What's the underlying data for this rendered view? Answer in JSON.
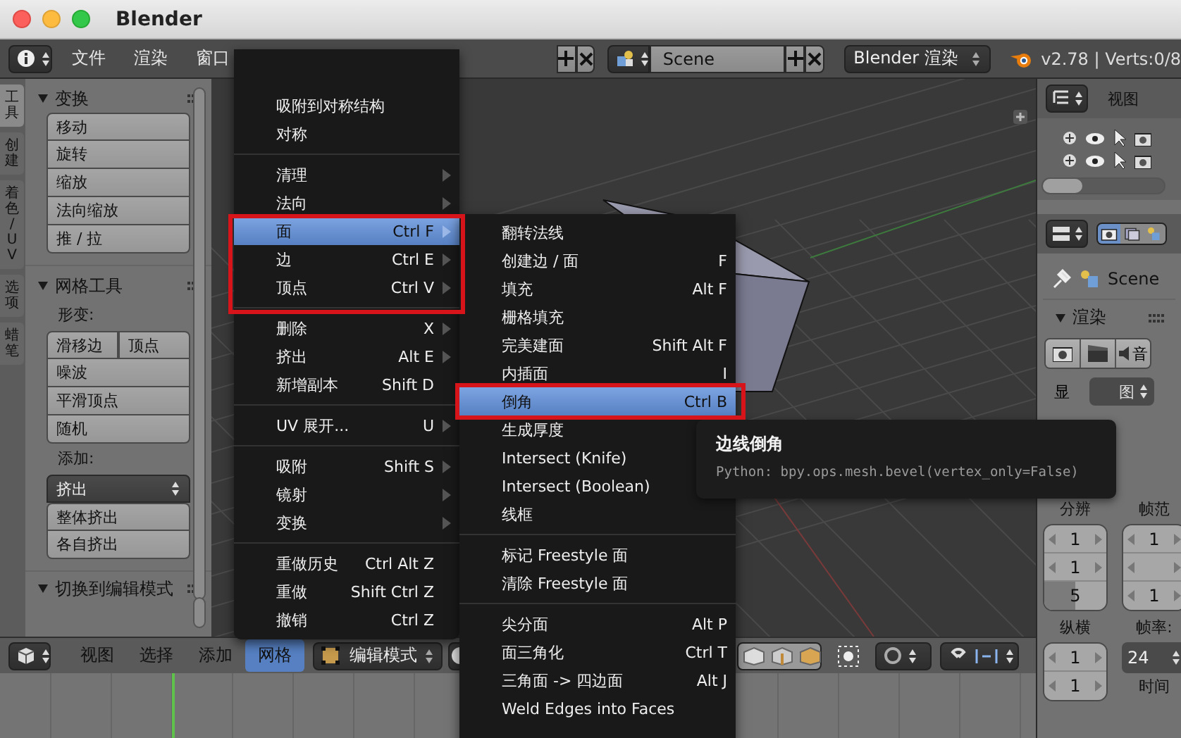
{
  "window": {
    "title": "Blender"
  },
  "top_header": {
    "menus": [
      {
        "label": "文件"
      },
      {
        "label": "渲染"
      },
      {
        "label": "窗口"
      }
    ],
    "scene": "Scene",
    "render_engine": "Blender 渲染",
    "version": "v2.78 | Verts:0/8"
  },
  "tool_tabs": [
    {
      "label": "工具",
      "selected": true
    },
    {
      "label": "创建",
      "selected": false
    },
    {
      "label": "着色 / UV",
      "selected": false
    },
    {
      "label": "选项",
      "selected": false
    },
    {
      "label": "蜡笔",
      "selected": false
    }
  ],
  "tool_shelf": {
    "panels": [
      {
        "title": "变换",
        "items": [
          {
            "kind": "button",
            "label": "移动"
          },
          {
            "kind": "button",
            "label": "旋转"
          },
          {
            "kind": "button",
            "label": "缩放"
          },
          {
            "kind": "button",
            "label": "法向缩放"
          },
          {
            "kind": "button",
            "label": "推 / 拉"
          }
        ]
      },
      {
        "title": "网格工具",
        "items": [
          {
            "kind": "label",
            "label": "形变:"
          },
          {
            "kind": "pair",
            "labels": [
              "滑移边",
              "顶点"
            ]
          },
          {
            "kind": "button",
            "label": "噪波"
          },
          {
            "kind": "button",
            "label": "平滑顶点"
          },
          {
            "kind": "button",
            "label": "随机"
          },
          {
            "kind": "label",
            "label": "添加:"
          },
          {
            "kind": "dropdown",
            "label": "挤出"
          },
          {
            "kind": "button",
            "label": "整体挤出"
          },
          {
            "kind": "button",
            "label": "各自挤出"
          }
        ]
      },
      {
        "title": "切换到编辑模式"
      }
    ]
  },
  "main_menu": {
    "items": [
      {
        "kind": "item",
        "label": "吸附到对称结构",
        "submenu": false,
        "selected": false
      },
      {
        "kind": "item",
        "label": "对称",
        "submenu": false,
        "selected": false
      },
      {
        "kind": "separator"
      },
      {
        "kind": "item",
        "label": "清理",
        "submenu": true,
        "selected": false
      },
      {
        "kind": "item",
        "label": "法向",
        "submenu": true,
        "selected": false
      },
      {
        "kind": "item",
        "label": "面",
        "shortcut": "Ctrl F",
        "submenu": true,
        "selected": true
      },
      {
        "kind": "item",
        "label": "边",
        "shortcut": "Ctrl E",
        "submenu": true,
        "selected": false
      },
      {
        "kind": "item",
        "label": "顶点",
        "shortcut": "Ctrl V",
        "submenu": true,
        "selected": false
      },
      {
        "kind": "separator"
      },
      {
        "kind": "item",
        "label": "删除",
        "shortcut": "X",
        "submenu": true,
        "selected": false
      },
      {
        "kind": "item",
        "label": "挤出",
        "shortcut": "Alt E",
        "submenu": true,
        "selected": false
      },
      {
        "kind": "item",
        "label": "新增副本",
        "shortcut": "Shift D",
        "submenu": false,
        "selected": false
      },
      {
        "kind": "separator"
      },
      {
        "kind": "item",
        "label": "UV 展开...",
        "shortcut": "U",
        "submenu": true,
        "selected": false
      },
      {
        "kind": "separator"
      },
      {
        "kind": "item",
        "label": "吸附",
        "shortcut": "Shift S",
        "submenu": true,
        "selected": false
      },
      {
        "kind": "item",
        "label": "镜射",
        "submenu": true,
        "selected": false
      },
      {
        "kind": "item",
        "label": "变换",
        "submenu": true,
        "selected": false
      },
      {
        "kind": "separator"
      },
      {
        "kind": "item",
        "label": "重做历史",
        "shortcut": "Ctrl Alt Z",
        "submenu": false,
        "selected": false
      },
      {
        "kind": "item",
        "label": "重做",
        "shortcut": "Shift Ctrl Z",
        "submenu": false,
        "selected": false
      },
      {
        "kind": "item",
        "label": "撤销",
        "shortcut": "Ctrl Z",
        "submenu": false,
        "selected": false
      }
    ]
  },
  "face_submenu": {
    "items": [
      {
        "kind": "item",
        "label": "翻转法线",
        "selected": false
      },
      {
        "kind": "item",
        "label": "创建边 / 面",
        "shortcut": "F",
        "selected": false
      },
      {
        "kind": "item",
        "label": "填充",
        "shortcut": "Alt F",
        "selected": false
      },
      {
        "kind": "item",
        "label": "栅格填充",
        "selected": false
      },
      {
        "kind": "item",
        "label": "完美建面",
        "shortcut": "Shift Alt F",
        "selected": false
      },
      {
        "kind": "item",
        "label": "内插面",
        "shortcut": "I",
        "selected": false
      },
      {
        "kind": "item",
        "label": "倒角",
        "shortcut": "Ctrl B",
        "selected": true
      },
      {
        "kind": "item",
        "label": "生成厚度",
        "selected": false
      },
      {
        "kind": "item",
        "label": "Intersect (Knife)",
        "selected": false
      },
      {
        "kind": "item",
        "label": "Intersect (Boolean)",
        "selected": false
      },
      {
        "kind": "item",
        "label": "线框",
        "selected": false
      },
      {
        "kind": "separator"
      },
      {
        "kind": "item",
        "label": "标记 Freestyle 面",
        "selected": false
      },
      {
        "kind": "item",
        "label": "清除 Freestyle 面",
        "selected": false
      },
      {
        "kind": "separator"
      },
      {
        "kind": "item",
        "label": "尖分面",
        "shortcut": "Alt P",
        "selected": false
      },
      {
        "kind": "item",
        "label": "面三角化",
        "shortcut": "Ctrl T",
        "selected": false
      },
      {
        "kind": "item",
        "label": "三角面 -> 四边面",
        "shortcut": "Alt J",
        "selected": false
      },
      {
        "kind": "item",
        "label": "Weld Edges into Faces",
        "selected": false
      }
    ]
  },
  "tooltip": {
    "title": "边线倒角",
    "python": "Python: bpy.ops.mesh.bevel(vertex_only=False)"
  },
  "bottom_header": {
    "menus": [
      {
        "label": "视图",
        "selected": false
      },
      {
        "label": "选择",
        "selected": false
      },
      {
        "label": "添加",
        "selected": false
      },
      {
        "label": "网格",
        "selected": true
      }
    ],
    "mode": "编辑模式"
  },
  "outliner": {
    "menu": "视图"
  },
  "properties": {
    "scene": "Scene",
    "render_title": "渲染",
    "audio_label": "音",
    "display_label": "显",
    "display_value": "图",
    "columns": [
      {
        "label": "分辨",
        "fields": [
          {
            "kind": "number",
            "value": "1"
          },
          {
            "kind": "number",
            "value": "1"
          },
          {
            "kind": "slider",
            "value": "5",
            "level": 0.5
          }
        ]
      },
      {
        "label": "帧范",
        "fields": [
          {
            "kind": "number",
            "value": "1"
          },
          {
            "kind": "blank"
          },
          {
            "kind": "number",
            "value": "1"
          }
        ]
      }
    ],
    "aspect": {
      "label": "纵横",
      "fields": [
        {
          "kind": "number",
          "value": "1"
        },
        {
          "kind": "number",
          "value": "1"
        }
      ]
    },
    "frame_rate": {
      "label": "帧率:",
      "value": "24"
    },
    "time_label": "时间"
  }
}
